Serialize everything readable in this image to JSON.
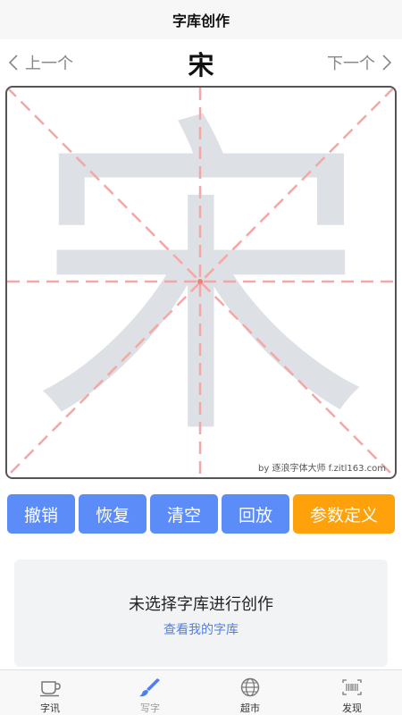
{
  "header": {
    "title": "字库创作"
  },
  "nav": {
    "prev_label": "上一个",
    "next_label": "下一个",
    "current_char": "宋"
  },
  "canvas": {
    "template_char": "宋",
    "watermark": "by 逐浪字体大师 f.zitl163.com",
    "guide_color": "#f4a7a7",
    "template_color": "#dde0e4"
  },
  "toolbar": {
    "undo_label": "撤销",
    "redo_label": "恢复",
    "clear_label": "清空",
    "replay_label": "回放",
    "params_label": "参数定义"
  },
  "empty_state": {
    "message": "未选择字库进行创作",
    "link_label": "查看我的字库"
  },
  "tabs": [
    {
      "label": "字讯",
      "icon": "coffee-cup-icon"
    },
    {
      "label": "写字",
      "icon": "brush-icon",
      "active": true
    },
    {
      "label": "超市",
      "icon": "globe-icon"
    },
    {
      "label": "发现",
      "icon": "barcode-scan-icon"
    }
  ],
  "colors": {
    "primary_blue": "#5b8cf7",
    "accent_orange": "#ffa10a",
    "link_blue": "#4c7fef"
  }
}
